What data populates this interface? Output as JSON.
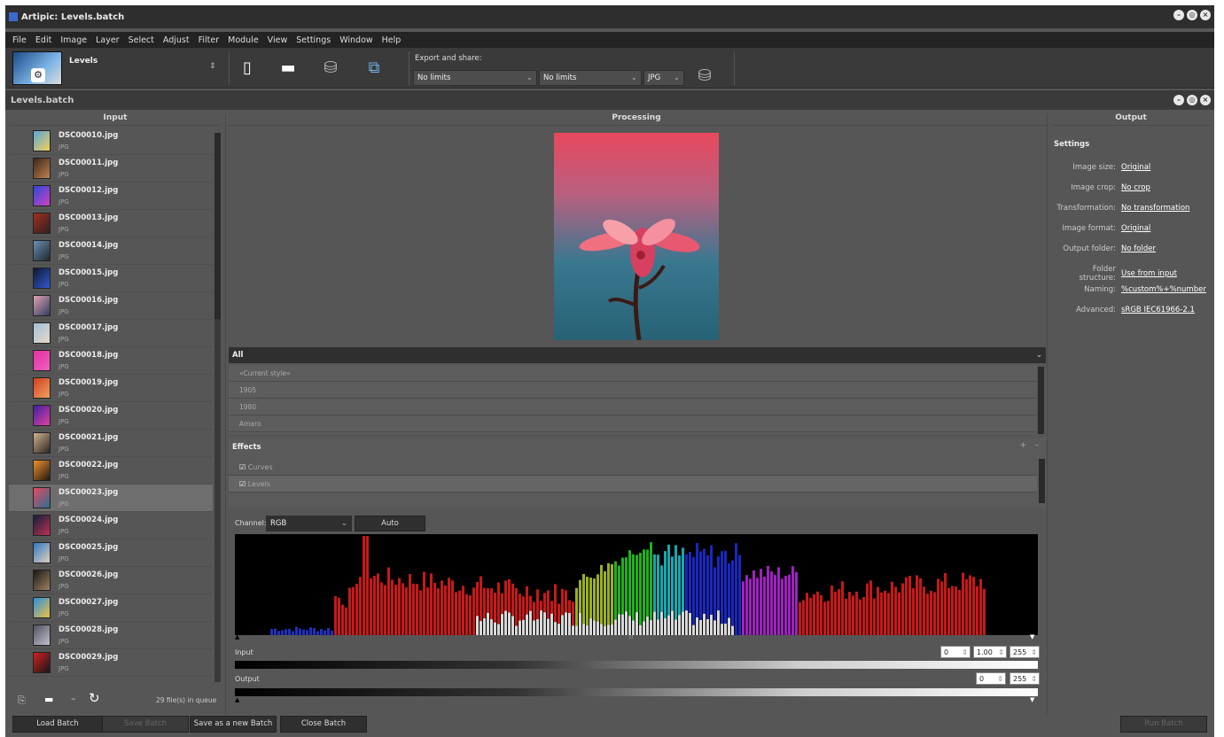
{
  "window": {
    "title": "Artipic: Levels.batch"
  },
  "menu": [
    "File",
    "Edit",
    "Image",
    "Layer",
    "Select",
    "Adjust",
    "Filter",
    "Module",
    "View",
    "Settings",
    "Window",
    "Help"
  ],
  "toolbar": {
    "preset_name": "Levels",
    "export_label": "Export and share:",
    "limit1": "No limits",
    "limit2": "No limits",
    "format": "JPG"
  },
  "doc": {
    "title": "Levels.batch"
  },
  "input": {
    "header": "Input",
    "files": [
      {
        "name": "DSC00010.jpg",
        "type": "JPG",
        "c1": "#5aa4d8",
        "c2": "#f2d25a"
      },
      {
        "name": "DSC00011.jpg",
        "type": "JPG",
        "c1": "#3a2618",
        "c2": "#c08050"
      },
      {
        "name": "DSC00012.jpg",
        "type": "JPG",
        "c1": "#2a4ad8",
        "c2": "#d040c0"
      },
      {
        "name": "DSC00013.jpg",
        "type": "JPG",
        "c1": "#a03020",
        "c2": "#302020"
      },
      {
        "name": "DSC00014.jpg",
        "type": "JPG",
        "c1": "#6890b0",
        "c2": "#202830"
      },
      {
        "name": "DSC00015.jpg",
        "type": "JPG",
        "c1": "#101830",
        "c2": "#3058d0"
      },
      {
        "name": "DSC00016.jpg",
        "type": "JPG",
        "c1": "#e0a0b0",
        "c2": "#304060"
      },
      {
        "name": "DSC00017.jpg",
        "type": "JPG",
        "c1": "#a0c0d8",
        "c2": "#e8d8c8"
      },
      {
        "name": "DSC00018.jpg",
        "type": "JPG",
        "c1": "#e030a0",
        "c2": "#f060c0"
      },
      {
        "name": "DSC00019.jpg",
        "type": "JPG",
        "c1": "#d04020",
        "c2": "#f0a060"
      },
      {
        "name": "DSC00020.jpg",
        "type": "JPG",
        "c1": "#4020a0",
        "c2": "#e040a0"
      },
      {
        "name": "DSC00021.jpg",
        "type": "JPG",
        "c1": "#d0b090",
        "c2": "#302820"
      },
      {
        "name": "DSC00022.jpg",
        "type": "JPG",
        "c1": "#f09030",
        "c2": "#201810"
      },
      {
        "name": "DSC00023.jpg",
        "type": "JPG",
        "c1": "#e84860",
        "c2": "#2a7090"
      },
      {
        "name": "DSC00024.jpg",
        "type": "JPG",
        "c1": "#102040",
        "c2": "#c03050"
      },
      {
        "name": "DSC00025.jpg",
        "type": "JPG",
        "c1": "#3078c0",
        "c2": "#e0d0c0"
      },
      {
        "name": "DSC00026.jpg",
        "type": "JPG",
        "c1": "#181818",
        "c2": "#a08060"
      },
      {
        "name": "DSC00027.jpg",
        "type": "JPG",
        "c1": "#2890e0",
        "c2": "#f0c040"
      },
      {
        "name": "DSC00028.jpg",
        "type": "JPG",
        "c1": "#505060",
        "c2": "#c0c0d0"
      },
      {
        "name": "DSC00029.jpg",
        "type": "JPG",
        "c1": "#d02020",
        "c2": "#181818"
      }
    ],
    "queue_text": "29 file(s) in queue",
    "selected_index": 13
  },
  "processing": {
    "header": "Processing",
    "style_filter": "All",
    "styles": [
      "«Current style»",
      "1905",
      "1980",
      "Amaro"
    ],
    "effects_title": "Effects",
    "effects": [
      {
        "label": "Curves",
        "checked": true
      },
      {
        "label": "Levels",
        "checked": true
      }
    ],
    "channel_label": "Channel:",
    "channel": "RGB",
    "auto_label": "Auto",
    "input_label": "Input",
    "output_label": "Output",
    "input_black": "0",
    "input_gamma": "1.00",
    "input_white": "255",
    "output_black": "0",
    "output_white": "255"
  },
  "output": {
    "header": "Output",
    "settings_title": "Settings",
    "rows": [
      {
        "label": "Image size:",
        "value": "Original"
      },
      {
        "label": "Image crop:",
        "value": "No crop"
      },
      {
        "label": "Transformation:",
        "value": "No transformation"
      },
      {
        "label": "Image format:",
        "value": "Original"
      },
      {
        "label": "Output folder:",
        "value": "No folder"
      },
      {
        "label": "Folder structure:",
        "value": "Use from input"
      },
      {
        "label": "Naming:",
        "value": "%custom%+%number"
      },
      {
        "label": "Advanced:",
        "value": "sRGB IEC61966-2.1"
      }
    ]
  },
  "footer": {
    "load": "Load Batch",
    "save": "Save Batch",
    "save_new": "Save as a new Batch",
    "close": "Close Batch",
    "run": "Run Batch"
  }
}
